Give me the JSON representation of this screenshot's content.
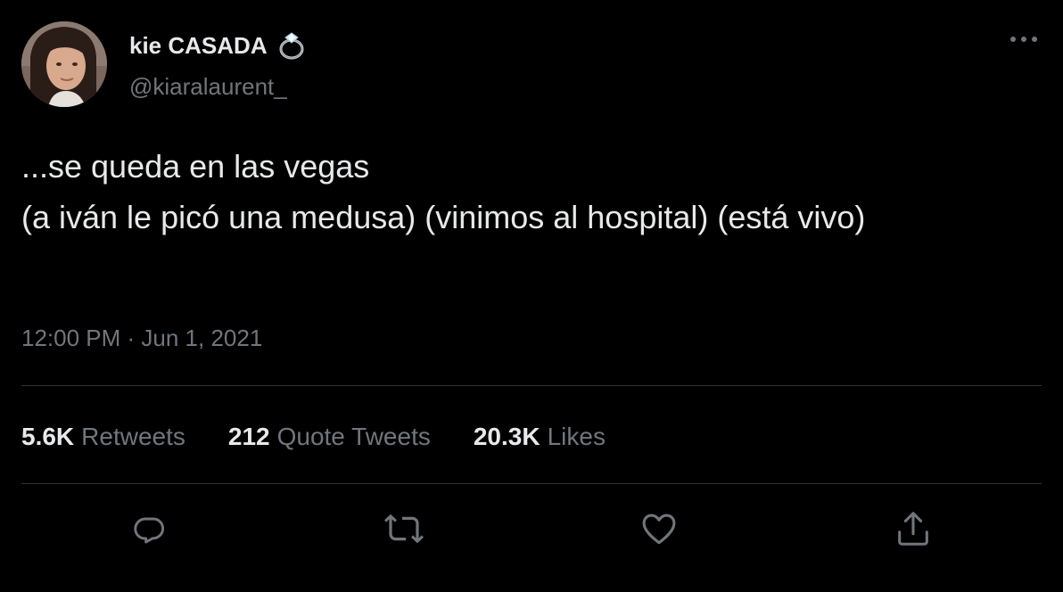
{
  "author": {
    "display_name": "kie CASADA",
    "name_emoji": "ring-icon",
    "handle": "@kiaralaurent_"
  },
  "tweet": {
    "text": "...se queda en las vegas\n(a iván le picó una medusa) (vinimos al hospital) (está vivo)",
    "timestamp": "12:00 PM · Jun 1, 2021"
  },
  "stats": [
    {
      "count": "5.6K",
      "label": "Retweets"
    },
    {
      "count": "212",
      "label": "Quote Tweets"
    },
    {
      "count": "20.3K",
      "label": "Likes"
    }
  ],
  "actions": [
    "reply-icon",
    "retweet-icon",
    "like-icon",
    "share-icon"
  ],
  "colors": {
    "background": "#000000",
    "primary_text": "#e7e9ea",
    "secondary_text": "#71767b",
    "divider": "#2f3336"
  }
}
